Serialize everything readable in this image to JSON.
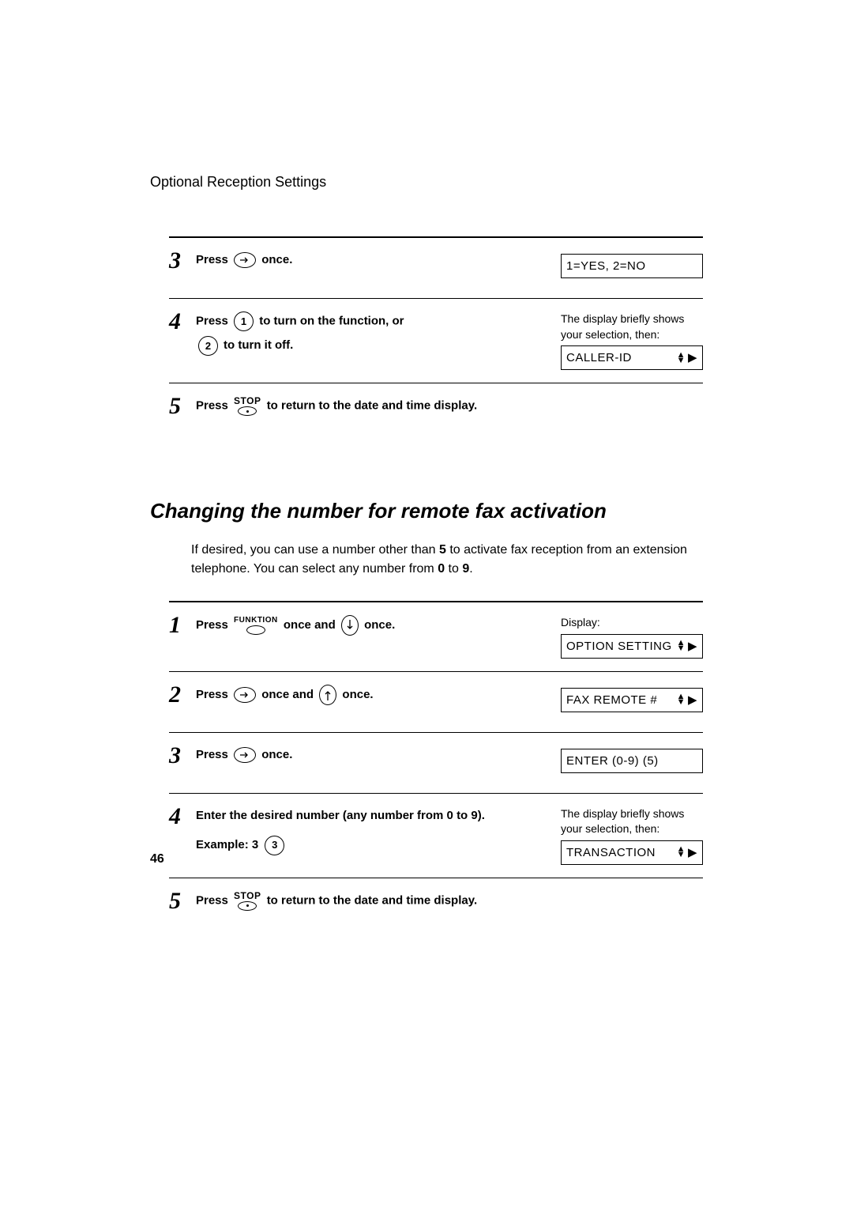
{
  "header": "Optional Reception Settings",
  "page_number": "46",
  "top_steps": {
    "s3": {
      "num": "3",
      "press": "Press",
      "after": "once.",
      "lcd": "1=YES, 2=NO"
    },
    "s4": {
      "num": "4",
      "press": "Press",
      "key1": "1",
      "mid": "to turn on the function, or",
      "key2": "2",
      "after2": "to turn it off.",
      "note1": "The display briefly shows your selection, then:",
      "lcd": "CALLER-ID"
    },
    "s5": {
      "num": "5",
      "press": "Press",
      "stop": "STOP",
      "after": "to return to the date and time display."
    }
  },
  "section_heading": "Changing the number for remote fax activation",
  "intro_pre": "If desired, you can use a number other than ",
  "intro_bold1": "5",
  "intro_mid": " to activate fax reception from an extension telephone. You can select any number from ",
  "intro_bold2": "0",
  "intro_to": " to ",
  "intro_bold3": "9",
  "intro_end": ".",
  "bottom_steps": {
    "s1": {
      "num": "1",
      "press": "Press",
      "funktion": "FUNKTION",
      "mid": "once and",
      "after": "once.",
      "display_label": "Display:",
      "lcd": "OPTION SETTING"
    },
    "s2": {
      "num": "2",
      "press": "Press",
      "mid": "once and",
      "after": "once.",
      "lcd": "FAX REMOTE #"
    },
    "s3": {
      "num": "3",
      "press": "Press",
      "after": "once.",
      "lcd": "ENTER (0-9) (5)"
    },
    "s4": {
      "num": "4",
      "line1": "Enter the desired number (any number from 0 to 9).",
      "example_label": "Example: 3",
      "key": "3",
      "note": "The display briefly shows your selection, then:",
      "lcd": "TRANSACTION"
    },
    "s5": {
      "num": "5",
      "press": "Press",
      "stop": "STOP",
      "after": "to return to the date and time display."
    }
  }
}
